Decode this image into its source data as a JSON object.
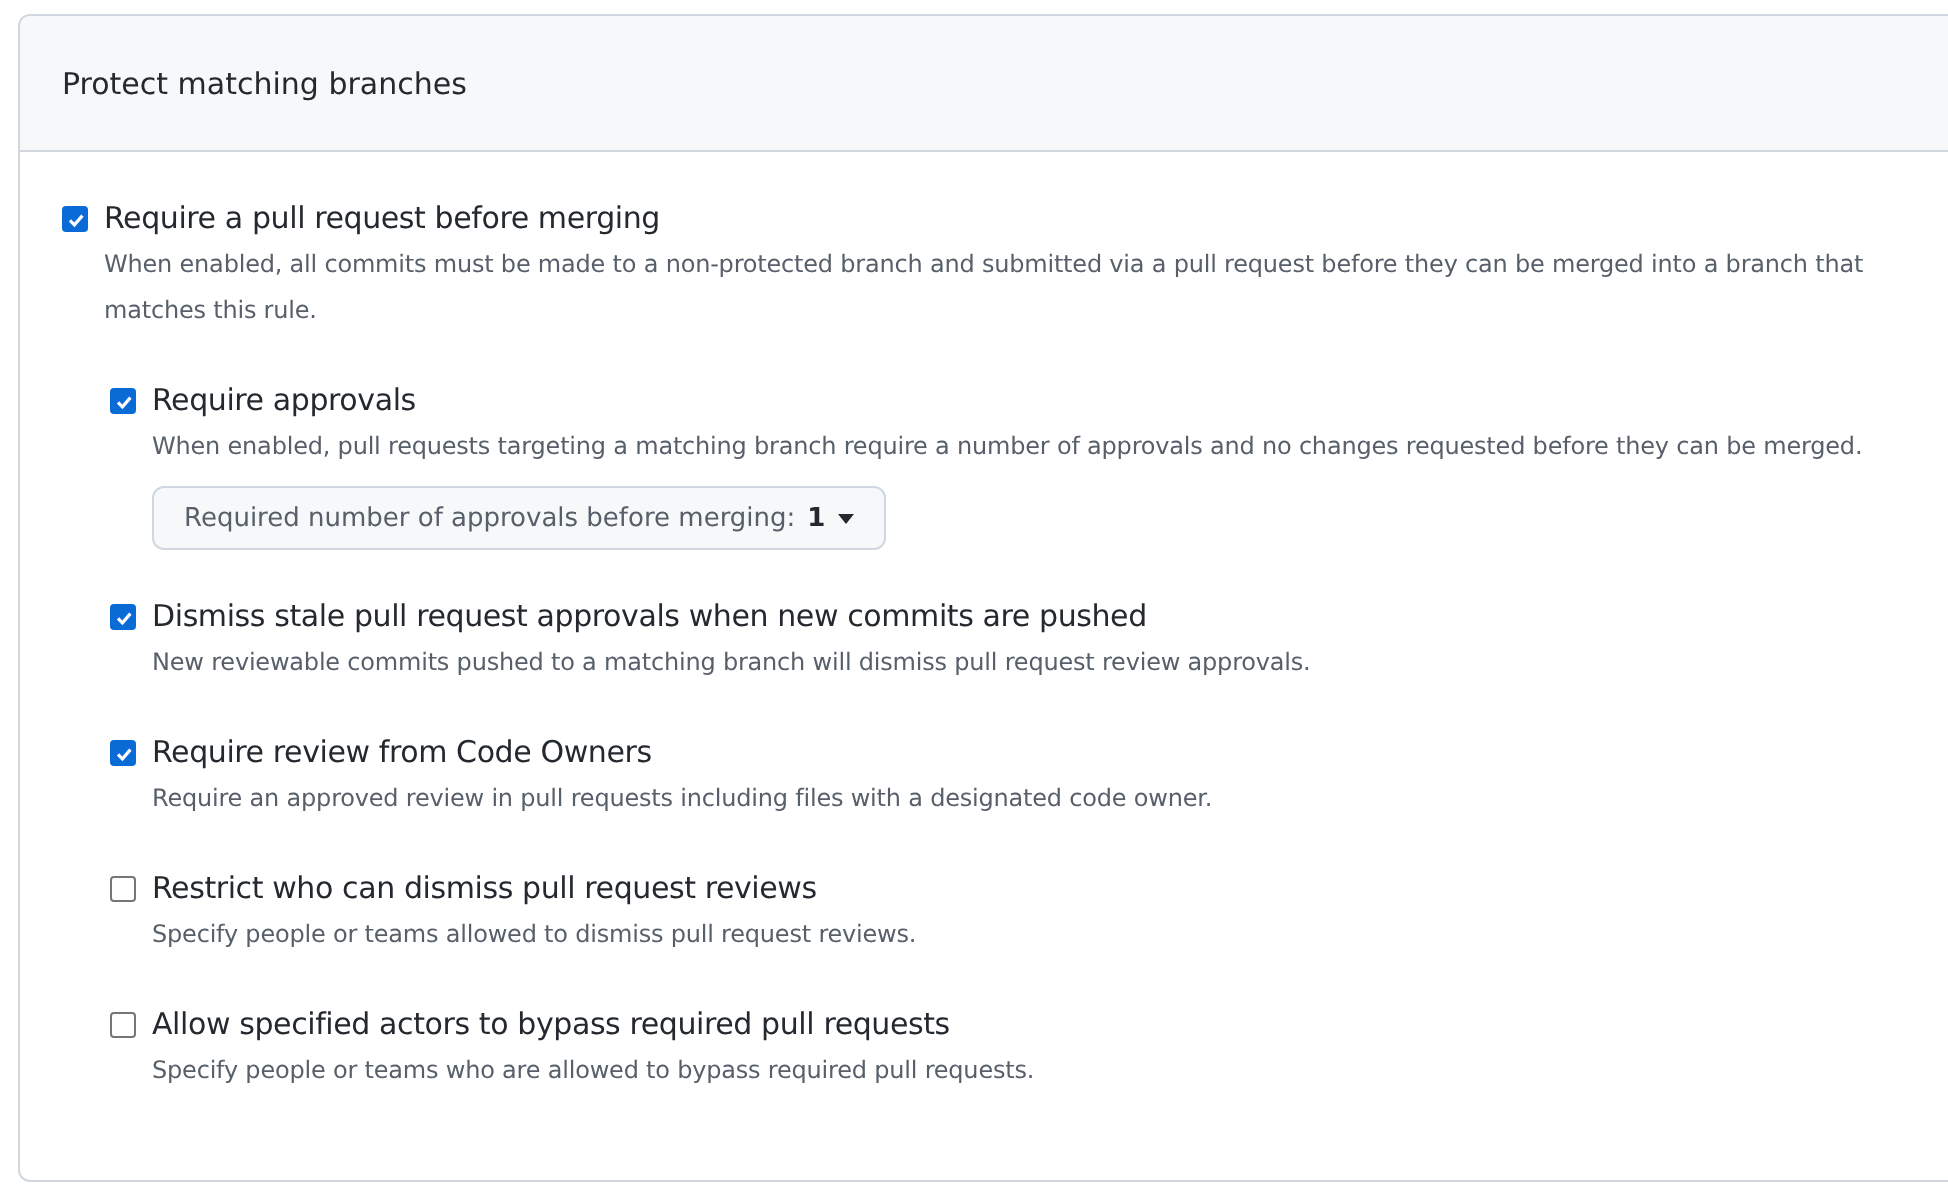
{
  "panel": {
    "title": "Protect matching branches"
  },
  "options": [
    {
      "label": "Require a pull request before merging",
      "checked": true,
      "description": "When enabled, all commits must be made to a non-protected branch and submitted via a pull request before they can be merged into a branch that matches this rule.",
      "children": [
        {
          "label": "Require approvals",
          "checked": true,
          "description": "When enabled, pull requests targeting a matching branch require a number of approvals and no changes requested before they can be merged.",
          "select": {
            "label": "Required number of approvals before merging:",
            "value": "1"
          }
        },
        {
          "label": "Dismiss stale pull request approvals when new commits are pushed",
          "checked": true,
          "description": "New reviewable commits pushed to a matching branch will dismiss pull request review approvals."
        },
        {
          "label": "Require review from Code Owners",
          "checked": true,
          "description": "Require an approved review in pull requests including files with a designated code owner."
        },
        {
          "label": "Restrict who can dismiss pull request reviews",
          "checked": false,
          "description": "Specify people or teams allowed to dismiss pull request reviews."
        },
        {
          "label": "Allow specified actors to bypass required pull requests",
          "checked": false,
          "description": "Specify people or teams who are allowed to bypass required pull requests."
        }
      ]
    }
  ]
}
